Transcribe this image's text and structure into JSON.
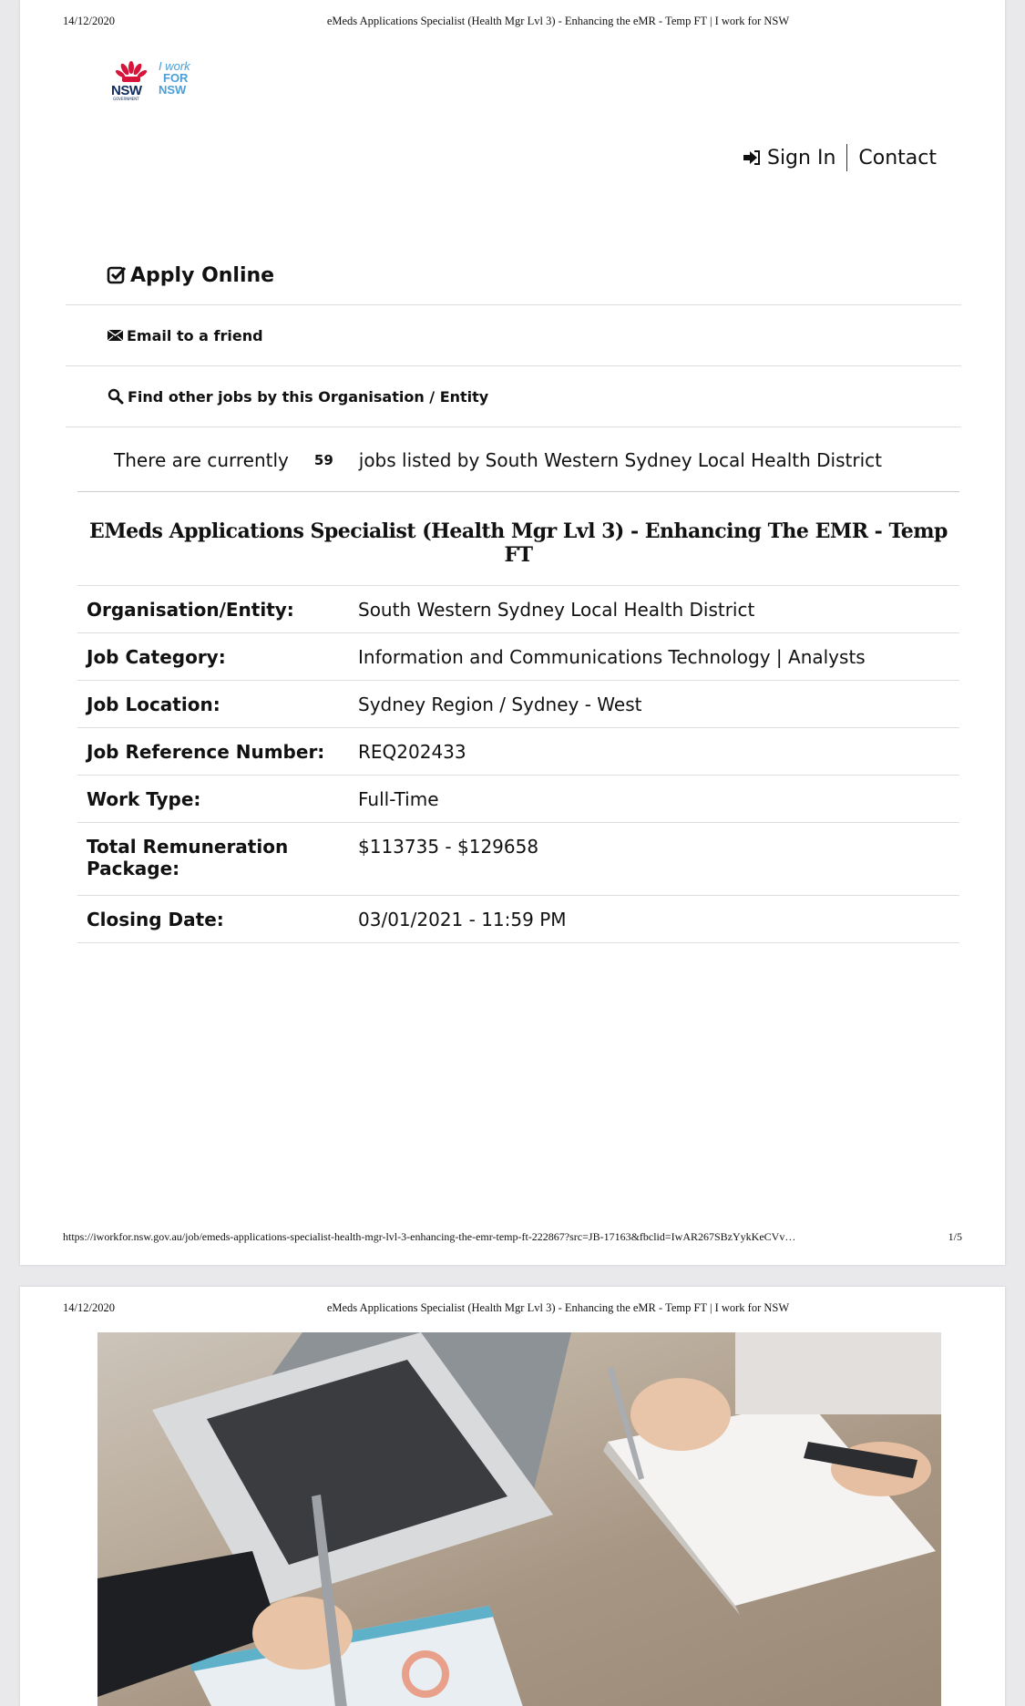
{
  "print_header": {
    "date": "14/12/2020",
    "title": "eMeds Applications Specialist (Health Mgr Lvl 3) - Enhancing the eMR - Temp FT | I work for NSW"
  },
  "logo": {
    "nsw": "NSW",
    "government": "GOVERNMENT",
    "i_work": "I work",
    "for": "FOR",
    "nsw2": "NSW"
  },
  "nav": {
    "sign_in": "Sign In",
    "contact": "Contact"
  },
  "actions": {
    "apply": "Apply Online",
    "email": "Email to a friend",
    "find": "Find other jobs by this Organisation / Entity"
  },
  "count": {
    "prefix": "There are currently",
    "number": "59",
    "suffix": "jobs listed by South Western Sydney Local Health District"
  },
  "job_title": "EMeds Applications Specialist (Health Mgr Lvl 3) - Enhancing The EMR - Temp FT",
  "details": [
    {
      "label": "Organisation/Entity:",
      "value": "South Western Sydney Local Health District"
    },
    {
      "label": "Job Category:",
      "value": "Information and Communications Technology | Analysts"
    },
    {
      "label": "Job Location:",
      "value": "Sydney Region / Sydney - West"
    },
    {
      "label": "Job Reference Number:",
      "value": "REQ202433"
    },
    {
      "label": "Work Type:",
      "value": "Full-Time"
    },
    {
      "label": "Total Remuneration Package:",
      "value": "$113735 - $129658"
    },
    {
      "label": "Closing Date:",
      "value": "03/01/2021 - 11:59 PM"
    }
  ],
  "print_footer": {
    "url": "https://iworkfor.nsw.gov.au/job/emeds-applications-specialist-health-mgr-lvl-3-enhancing-the-emr-temp-ft-222867?src=JB-17163&fbclid=IwAR267SBzYykKeCVv…",
    "page": "1/5"
  },
  "page2_header": {
    "date": "14/12/2020",
    "title": "eMeds Applications Specialist (Health Mgr Lvl 3) - Enhancing the eMR - Temp FT | I work for NSW"
  }
}
